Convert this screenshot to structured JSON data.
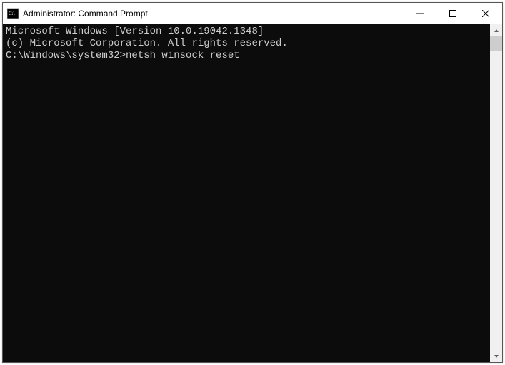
{
  "window": {
    "title": "Administrator: Command Prompt"
  },
  "terminal": {
    "lines": [
      "Microsoft Windows [Version 10.0.19042.1348]",
      "(c) Microsoft Corporation. All rights reserved.",
      "",
      "C:\\Windows\\system32>netsh winsock reset"
    ],
    "prompt": "C:\\Windows\\system32>",
    "command": "netsh winsock reset"
  }
}
